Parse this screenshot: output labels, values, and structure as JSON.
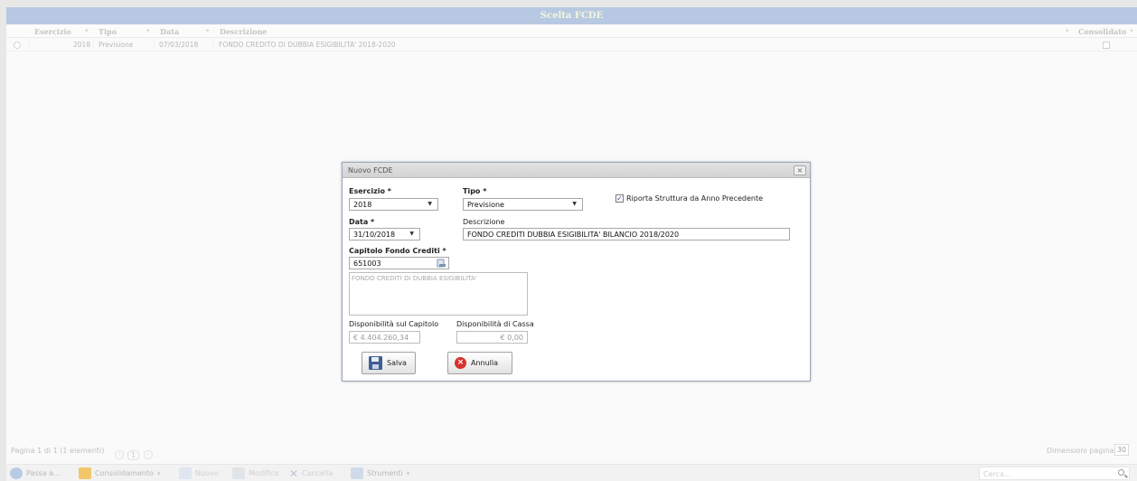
{
  "window": {
    "title": "Scelta FCDE"
  },
  "grid": {
    "columns": {
      "esercizio": "Esercizio",
      "tipo": "Tipo",
      "data": "Data",
      "descrizione": "Descrizione",
      "consolidato": "Consolidato"
    },
    "rows": [
      {
        "esercizio": "2018",
        "tipo": "Previsione",
        "data": "07/03/2018",
        "descrizione": "FONDO CREDITO DI DUBBIA ESIGIBILITA' 2018-2020",
        "consolidato": false
      }
    ]
  },
  "pager": {
    "info": "Pagina 1 di 1 (1 elementi)",
    "current_page": "1",
    "page_size_label": "Dimensioni pagina:",
    "page_size": "30"
  },
  "toolbar": {
    "passa": "Passa a...",
    "consolidamento": "Consolidamento",
    "nuovo": "Nuovo",
    "modifica": "Modifica",
    "cancella": "Cancella",
    "strumenti": "Strumenti",
    "search_placeholder": "Cerca..."
  },
  "modal": {
    "title": "Nuovo FCDE",
    "close": "×",
    "esercizio_label": "Esercizio *",
    "esercizio_value": "2018",
    "tipo_label": "Tipo *",
    "tipo_value": "Previsione",
    "riporta_label": "Riporta Struttura da Anno Precedente",
    "riporta_checked": true,
    "data_label": "Data *",
    "data_value": "31/10/2018",
    "descrizione_label": "Descrizione",
    "descrizione_value": "FONDO CREDITI DUBBIA ESIGIBILITA' BILANCIO 2018/2020",
    "capitolo_label": "Capitolo Fondo Crediti *",
    "capitolo_value": "651003",
    "capitolo_desc": "FONDO CREDITI DI DUBBIA ESIGIBILITA'",
    "disp_capitolo_label": "Disponibilità sul Capitolo",
    "disp_capitolo_value": "€ 4.404.260,34",
    "disp_cassa_label": "Disponibilità di Cassa",
    "disp_cassa_value": "€ 0,00",
    "salva": "Salva",
    "annulla": "Annulla"
  }
}
